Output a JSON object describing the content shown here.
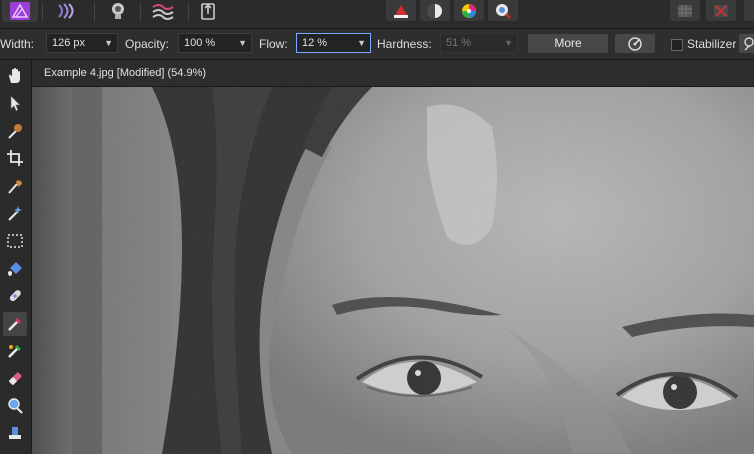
{
  "toolbar_top": {
    "personas": [
      "photo-persona-icon",
      "liquify-persona-icon",
      "develop-persona-icon",
      "tone-mapping-persona-icon",
      "export-persona-icon"
    ],
    "center_buttons": [
      "brush-icon",
      "blend-icon",
      "color-wheel-icon",
      "magic-icon"
    ],
    "right_buttons": [
      "grid-icon",
      "close-red-icon"
    ]
  },
  "context": {
    "width_label": "Width:",
    "width_value": "126 px",
    "opacity_label": "Opacity:",
    "opacity_value": "100 %",
    "flow_label": "Flow:",
    "flow_value": "12 %",
    "hardness_label": "Hardness:",
    "hardness_value": "51 %",
    "more_label": "More",
    "stabilizer_label": "Stabilizer"
  },
  "tools": [
    "hand-icon",
    "move-icon",
    "color-picker-icon",
    "crop-icon",
    "selection-brush-icon",
    "magic-wand-icon",
    "marquee-icon",
    "flood-fill-icon",
    "healing-icon",
    "paint-brush-icon",
    "paint-mixer-icon",
    "eraser-icon",
    "zoom-icon",
    "clone-stamp-icon"
  ],
  "document": {
    "tab_title": "Example 4.jpg [Modified] (54.9%)"
  },
  "colors": {
    "accent_focus": "#7aa7ff",
    "persona_purple": "#9b3fd8",
    "close_red": "#d03030"
  }
}
